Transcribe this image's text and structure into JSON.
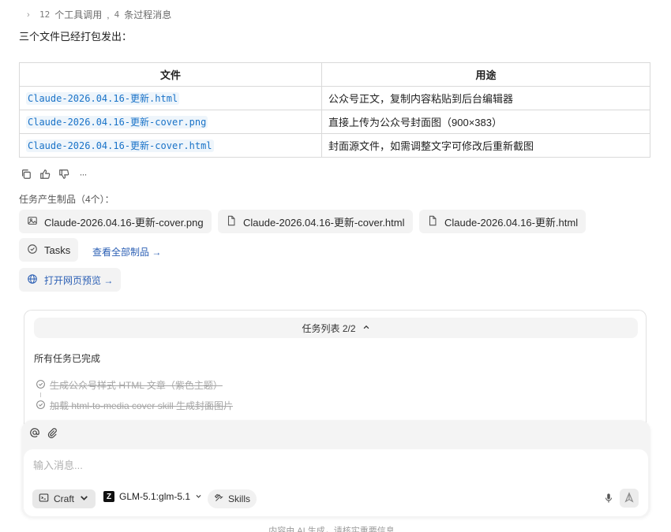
{
  "tool_summary": {
    "tool_count": "12",
    "tool_text": "个工具调用",
    "separator": ",",
    "message_count": "4",
    "message_text": "条过程消息"
  },
  "intro": "三个文件已经打包发出：",
  "table": {
    "headers": [
      "文件",
      "用途"
    ],
    "rows": [
      [
        "Claude-2026.04.16-更新.html",
        "公众号正文，复制内容粘贴到后台编辑器"
      ],
      [
        "Claude-2026.04.16-更新-cover.png",
        "直接上传为公众号封面图（900×383）"
      ],
      [
        "Claude-2026.04.16-更新-cover.html",
        "封面源文件，如需调整文字可修改后重新截图"
      ]
    ]
  },
  "actions": {
    "more_label": "···"
  },
  "products": {
    "label": "任务产生制品（4个）：",
    "items": [
      {
        "name": "Claude-2026.04.16-更新-cover.png",
        "icon": "image-icon"
      },
      {
        "name": "Claude-2026.04.16-更新-cover.html",
        "icon": "file-icon"
      },
      {
        "name": "Claude-2026.04.16-更新.html",
        "icon": "file-icon"
      },
      {
        "name": "Tasks",
        "icon": "check-circle-icon"
      }
    ],
    "view_all": "查看全部制品 →",
    "preview": "打开网页预览 →"
  },
  "tasks": {
    "title": "任务列表 2/2",
    "status": "所有任务已完成",
    "items": [
      "生成公众号样式 HTML 文章（紫色主题）",
      "加载 html-to-media cover skill 生成封面图片"
    ]
  },
  "composer": {
    "placeholder": "输入消息...",
    "mode_label": "Craft",
    "model_label": "GLM-5.1:glm-5.1",
    "skills_label": "Skills"
  },
  "footer": "内容由 AI 生成，请核实重要信息"
}
